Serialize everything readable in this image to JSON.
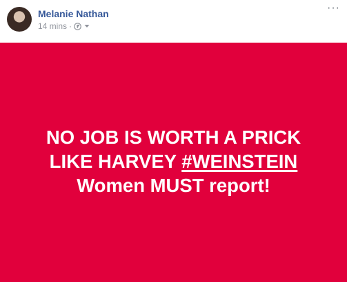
{
  "post": {
    "author": "Melanie Nathan",
    "timestamp": "14 mins",
    "separator": "·",
    "privacy_icon": "globe-icon",
    "audience_dropdown_icon": "chevron-down-icon",
    "more_options": "···"
  },
  "image": {
    "background_color": "#e1003c",
    "line1": "NO JOB IS WORTH A PRICK",
    "line2_prefix": "LIKE HARVEY ",
    "line2_hashtag": "#WEINSTEIN",
    "line3": "Women MUST report!"
  }
}
